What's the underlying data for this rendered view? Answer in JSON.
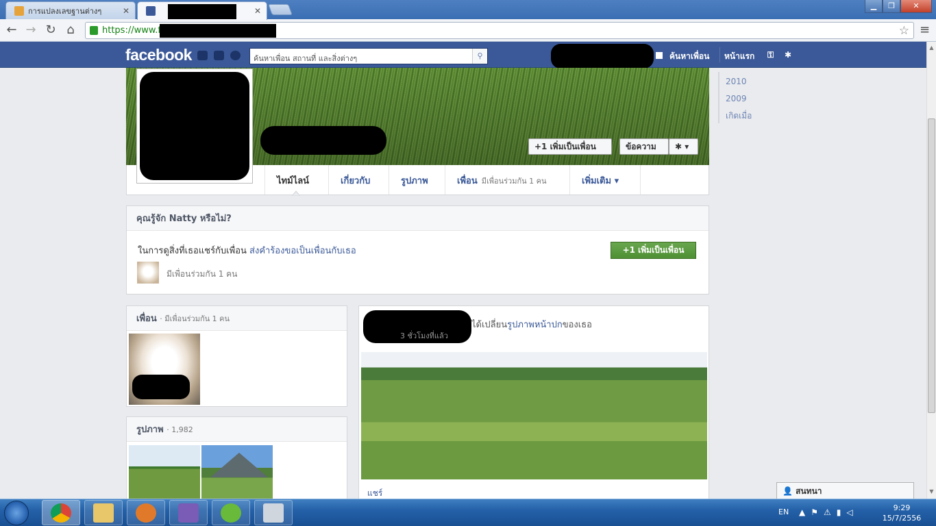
{
  "browser": {
    "tabs": [
      {
        "title": "การแปลงเลขฐานต่างๆ",
        "favicon": "page-icon",
        "active": false
      },
      {
        "title": "",
        "favicon": "facebook-icon",
        "active": true
      }
    ],
    "url": "https://www.facebook.com/macand",
    "window_buttons": [
      "minimize",
      "maximize",
      "close"
    ]
  },
  "fb": {
    "logo": "facebook",
    "search_placeholder": "ค้นหาเพื่อน สถานที่ และสิ่งต่างๆ",
    "find_friends": "ค้นหาเพื่อน",
    "home": "หน้าแรก",
    "brand_color": "#3b5998"
  },
  "profile": {
    "add_friend": "+1 เพิ่มเป็นเพื่อน",
    "message": "ข้อความ",
    "gear": "✱ ▾",
    "nav": [
      {
        "label": "ไทม์ไลน์",
        "sub": ""
      },
      {
        "label": "เกี่ยวกับ",
        "sub": ""
      },
      {
        "label": "รูปภาพ",
        "sub": ""
      },
      {
        "label": "เพื่อน",
        "sub": "มีเพื่อนร่วมกัน 1 คน"
      },
      {
        "label": "เพิ่มเติม ▾",
        "sub": ""
      }
    ]
  },
  "know_box": {
    "title": "คุณรู้จัก Natty หรือไม่?",
    "text": "ในการดูสิ่งที่เธอแชร์กับเพื่อน",
    "link": "ส่งคำร้องขอเป็นเพื่อนกับเธอ",
    "mutual": "มีเพื่อนร่วมกัน 1 คน",
    "button": "+1 เพิ่มเป็นเพื่อน",
    "button_color": "#5b9b3f"
  },
  "friends_box": {
    "title": "เพื่อน",
    "sub": "· มีเพื่อนร่วมกัน 1 คน"
  },
  "photos_box": {
    "title": "รูปภาพ",
    "sub": "· 1,982"
  },
  "story": {
    "action_prefix": "ได้เปลี่ยน",
    "action_link": "รูปภาพหน้าปก",
    "action_suffix": "ของเธอ",
    "time": "3 ชั่วโมงที่แล้ว",
    "share": "แชร์"
  },
  "years": [
    "2010",
    "2009",
    "เกิดเมื่อ"
  ],
  "chat": {
    "label": "สนทนา"
  },
  "taskbar": {
    "apps": [
      "chrome",
      "explorer",
      "media-player",
      "visual-studio",
      "utorrent",
      "calculator"
    ],
    "lang": "EN",
    "time": "9:29",
    "date": "15/7/2556"
  }
}
